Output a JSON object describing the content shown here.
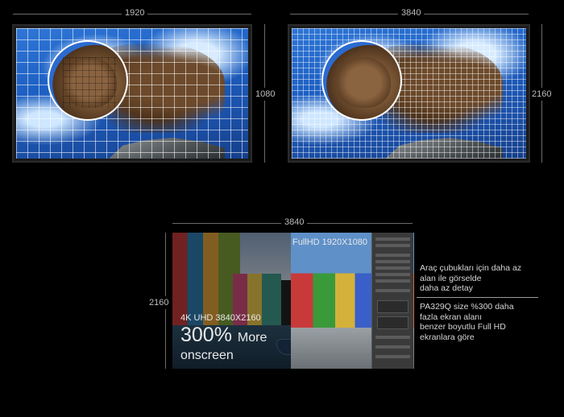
{
  "top_left": {
    "width_label": "1920",
    "height_label": "1080"
  },
  "top_right": {
    "width_label": "3840",
    "height_label": "2160"
  },
  "bottom": {
    "width_label": "3840",
    "height_label": "2160",
    "fullhd_label": "FullHD 1920X1080",
    "uhd_label": "4K UHD 3840X2160",
    "percent_label": "300%",
    "more_label": "More",
    "onscreen_label": "onscreen"
  },
  "notes": {
    "note1_line1": "Araç çubukları için daha az",
    "note1_line2": "alan ile görselde",
    "note1_line3": "daha az detay",
    "note2_line1": "PA329Q size %300 daha",
    "note2_line2": "fazla ekran alanı",
    "note2_line3": "benzer boyutlu Full HD",
    "note2_line4": "ekranlara göre"
  },
  "colors": {
    "background": "#000000",
    "grid_line": "#ffffff",
    "label_text": "#bdbdbd"
  }
}
